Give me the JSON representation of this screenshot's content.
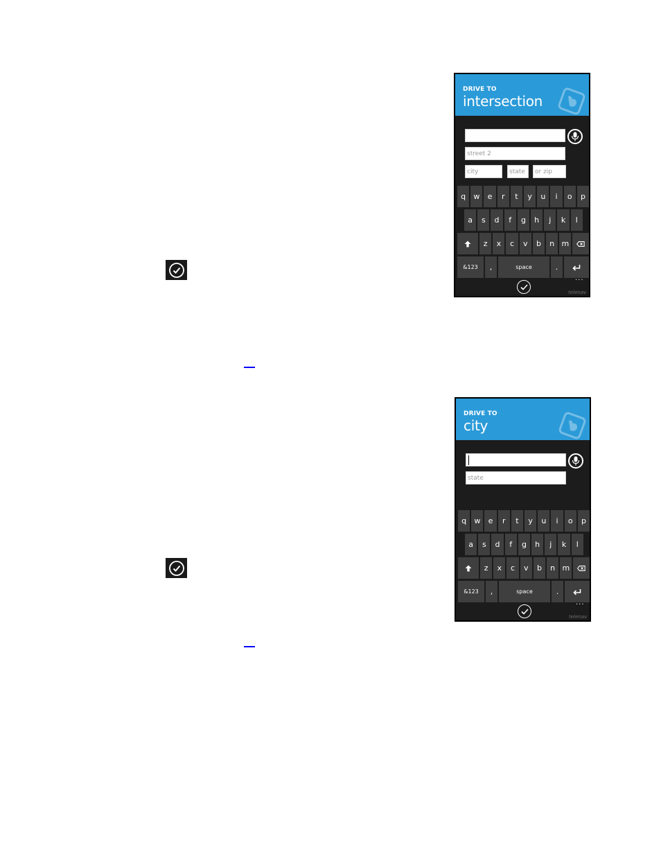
{
  "document": {
    "inline_icons": [
      {
        "name": "accept-check-icon"
      },
      {
        "name": "accept-check-icon"
      }
    ],
    "links": [
      {
        "text": ""
      },
      {
        "text": ""
      }
    ]
  },
  "screens": [
    {
      "header": {
        "kicker": "DRIVE TO",
        "title": "intersection"
      },
      "fields": [
        {
          "name": "street-1-field",
          "value": "",
          "placeholder": ""
        },
        {
          "name": "street-2-field",
          "value": "",
          "placeholder": "street 2"
        },
        {
          "name": "city-field",
          "value": "",
          "placeholder": "city"
        },
        {
          "name": "state-field",
          "value": "",
          "placeholder": "state"
        },
        {
          "name": "zip-field",
          "value": "",
          "placeholder": "or zip"
        }
      ],
      "mic_icon": "microphone-icon",
      "appbar": {
        "confirm_icon": "check-circle-icon",
        "more": "..."
      },
      "brand": "telenav"
    },
    {
      "header": {
        "kicker": "DRIVE TO",
        "title": "city"
      },
      "fields": [
        {
          "name": "city-field",
          "value": "",
          "placeholder": ""
        },
        {
          "name": "state-field",
          "value": "",
          "placeholder": "state"
        }
      ],
      "mic_icon": "microphone-icon",
      "appbar": {
        "confirm_icon": "check-circle-icon",
        "more": "..."
      },
      "brand": "telenav"
    }
  ],
  "keyboard": {
    "row1": [
      "q",
      "w",
      "e",
      "r",
      "t",
      "y",
      "u",
      "i",
      "o",
      "p"
    ],
    "row2": [
      "a",
      "s",
      "d",
      "f",
      "g",
      "h",
      "j",
      "k",
      "l"
    ],
    "row3": [
      "z",
      "x",
      "c",
      "v",
      "b",
      "n",
      "m"
    ],
    "shift_icon": "shift-arrow-icon",
    "backspace_icon": "backspace-icon",
    "symbols": "&123",
    "comma": ",",
    "space": "space",
    "period": ".",
    "enter_icon": "enter-icon"
  }
}
